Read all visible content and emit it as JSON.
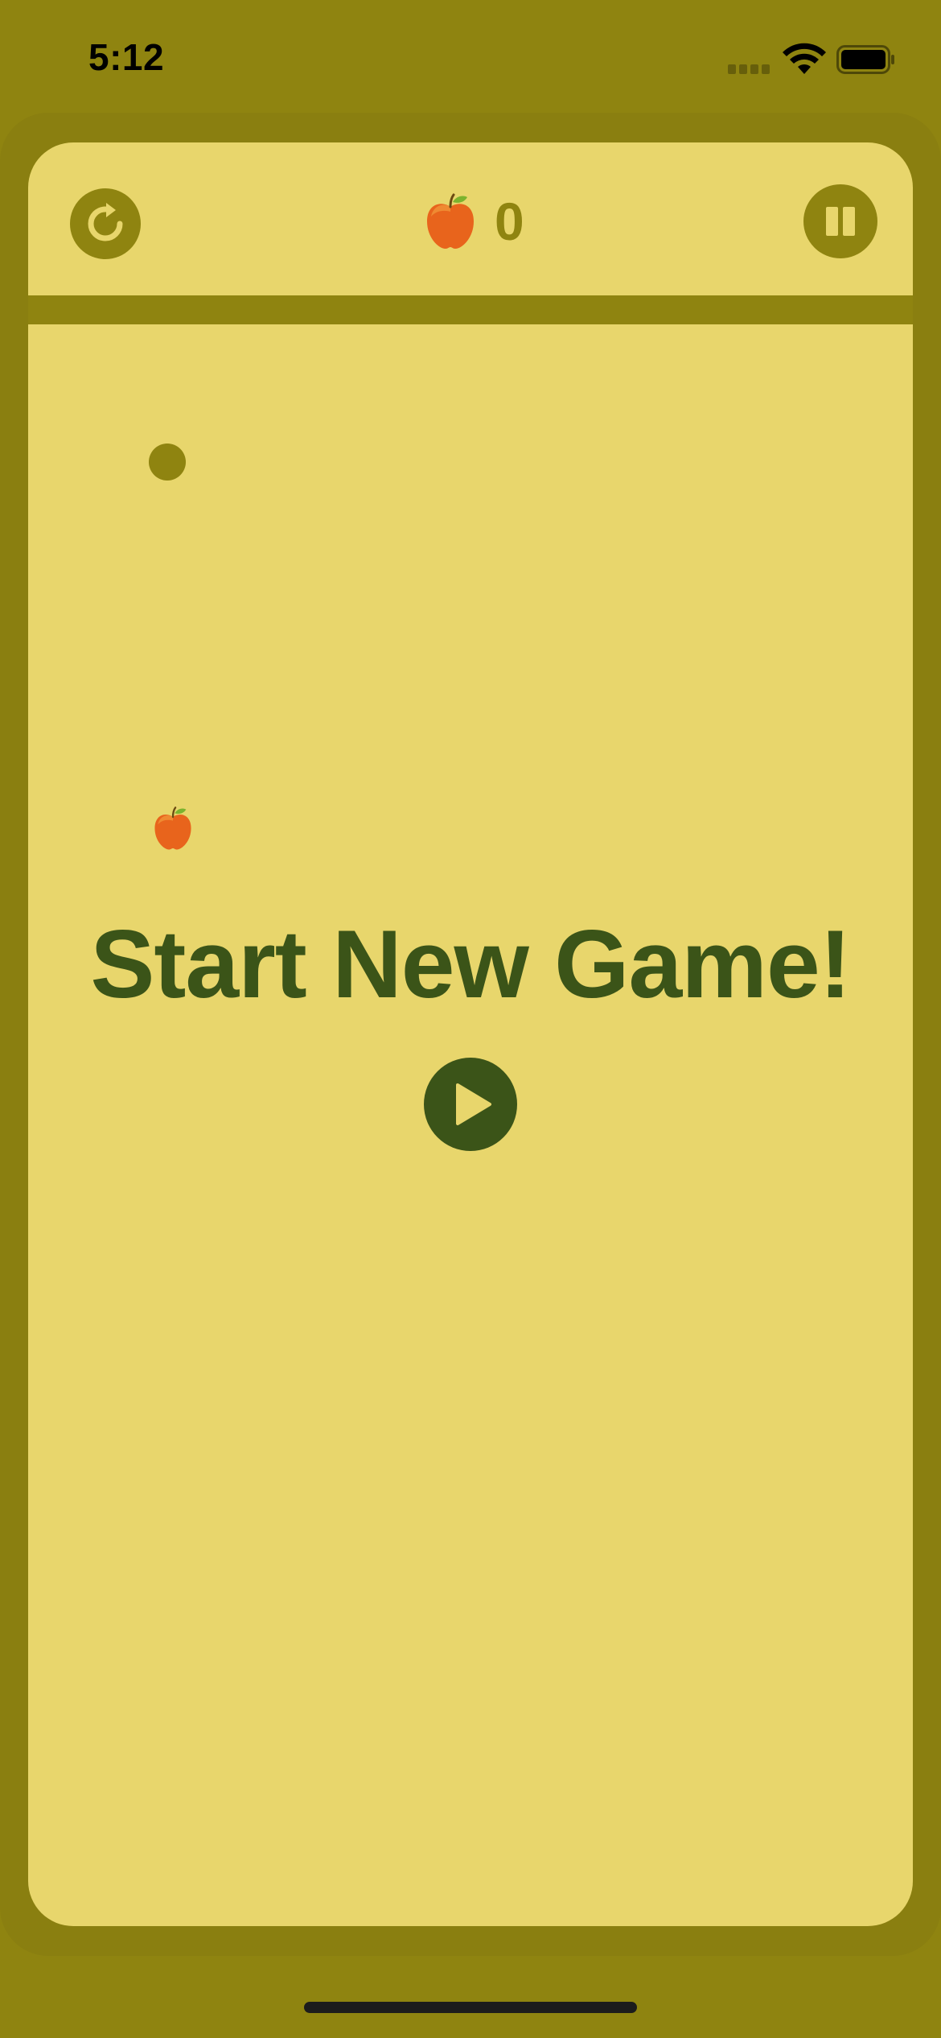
{
  "status_bar": {
    "time": "5:12",
    "cellular_icon": "cell-signal-icon",
    "wifi_icon": "wifi-icon",
    "battery_icon": "battery-full-icon"
  },
  "top_bar": {
    "restart_icon": "restart-icon",
    "score_icon": "apple-icon",
    "score": "0",
    "pause_icon": "pause-icon"
  },
  "game": {
    "title": "Start New Game!",
    "play_icon": "play-icon",
    "snake_head_icon": "snake-head",
    "food_icon": "apple-icon"
  },
  "colors": {
    "background": "#8f8410",
    "card": "#e8d66c",
    "accent_dark": "#3b5418",
    "accent_olive": "#8f8410"
  }
}
